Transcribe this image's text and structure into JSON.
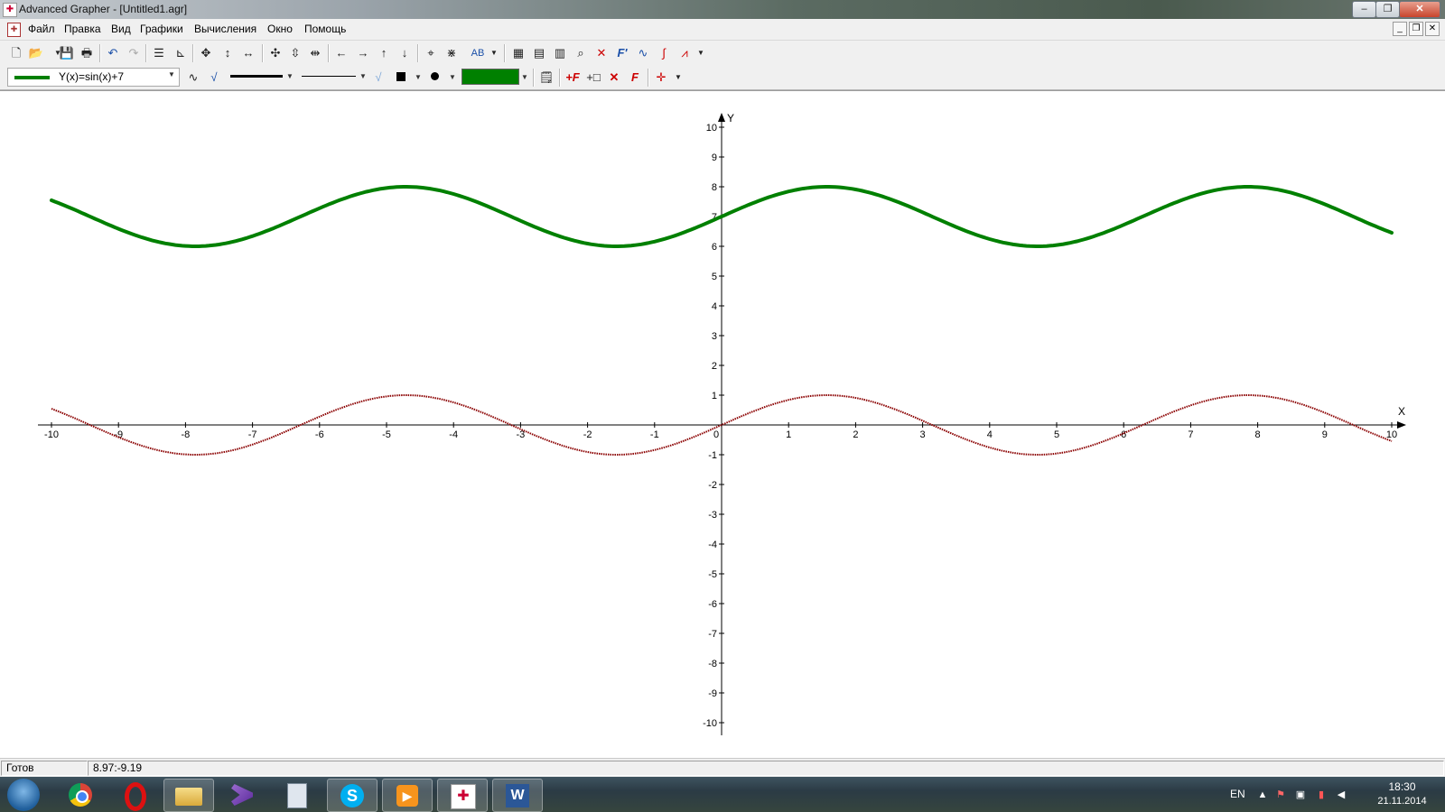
{
  "window": {
    "title": "Advanced Grapher - [Untitled1.agr]",
    "minimize": "–",
    "restore": "❐",
    "close": "✕"
  },
  "menu": [
    "Файл",
    "Правка",
    "Вид",
    "Графики",
    "Вычисления",
    "Окно",
    "Помощь"
  ],
  "mdi_controls": {
    "minimize": "_",
    "restore": "❐",
    "close": "✕"
  },
  "toolbar2": {
    "function_label": "Y(x)=sin(x)+7",
    "function_color": "#008000",
    "fill_color": "#008000"
  },
  "status": {
    "state": "Готов",
    "coords": "8.97:-9.19"
  },
  "taskbar": {
    "lang": "EN",
    "time": "18:30",
    "date": "21.11.2014"
  },
  "colors": {
    "curve1": "#008000",
    "curve2": "#8b0000",
    "axis": "#000000"
  },
  "icons": {
    "toolbar1": [
      "new-file-icon",
      "open-icon",
      "save-icon",
      "print-icon",
      "undo-icon",
      "redo-icon",
      "list-icon",
      "axes-icon",
      "move-icon",
      "vertical-arrows-icon",
      "horizontal-arrows-icon",
      "zoom-in-icon",
      "vertical-zoom-icon",
      "horizontal-zoom-icon",
      "left-arrow-icon",
      "right-arrow-icon",
      "up-arrow-icon",
      "down-arrow-icon",
      "crosshair-icon",
      "grid-icon",
      "label-icon",
      "table-icon",
      "calculator-icon",
      "spreadsheet-icon",
      "zoom-glass-icon",
      "intersection-icon",
      "derivative-icon",
      "tangent-icon",
      "integral-icon",
      "chart-icon"
    ],
    "toolbar2": [
      "curve-icon",
      "check-icon",
      "line-style-icon",
      "thin-line-icon",
      "square-marker-icon",
      "dot-marker-icon",
      "settings-icon",
      "add-function-icon",
      "add-table-icon",
      "delete-icon",
      "function-f-icon",
      "point-icon"
    ]
  },
  "chart_data": {
    "type": "line",
    "xlabel": "X",
    "ylabel": "Y",
    "xlim": [
      -10,
      10
    ],
    "ylim": [
      -10,
      10
    ],
    "x_ticks": [
      "-10",
      "-9",
      "-8",
      "-7",
      "-6",
      "-5",
      "-4",
      "-3",
      "-2",
      "-1",
      "0",
      "1",
      "2",
      "3",
      "4",
      "5",
      "6",
      "7",
      "8",
      "9",
      "10"
    ],
    "y_ticks": [
      "10",
      "9",
      "8",
      "7",
      "6",
      "5",
      "4",
      "3",
      "2",
      "1",
      "-1",
      "-2",
      "-3",
      "-4",
      "-5",
      "-6",
      "-7",
      "-8",
      "-9",
      "-10"
    ],
    "grid": false,
    "series": [
      {
        "name": "Y(x)=sin(x)+7",
        "formula": "sin(x)+7",
        "color": "#008000",
        "style": "thick",
        "x": [
          -10,
          -9,
          -8,
          -7,
          -6,
          -5,
          -4,
          -3,
          -2,
          -1,
          0,
          1,
          2,
          3,
          4,
          5,
          6,
          7,
          8,
          9,
          10
        ],
        "y": [
          7.54,
          6.59,
          6.01,
          6.34,
          7.28,
          7.96,
          7.76,
          6.86,
          6.09,
          6.16,
          7.0,
          7.84,
          7.91,
          7.14,
          6.24,
          6.04,
          6.72,
          7.66,
          7.99,
          7.41,
          6.46
        ]
      },
      {
        "formula": "sin(x)",
        "color": "#8b0000",
        "style": "dotted",
        "x": [
          -10,
          -9,
          -8,
          -7,
          -6,
          -5,
          -4,
          -3,
          -2,
          -1,
          0,
          1,
          2,
          3,
          4,
          5,
          6,
          7,
          8,
          9,
          10
        ],
        "y": [
          0.54,
          -0.41,
          -0.99,
          -0.66,
          0.28,
          0.96,
          0.76,
          -0.14,
          -0.91,
          -0.84,
          0.0,
          0.84,
          0.91,
          0.14,
          -0.76,
          -0.96,
          -0.28,
          0.66,
          0.99,
          0.41,
          -0.54
        ]
      }
    ]
  }
}
